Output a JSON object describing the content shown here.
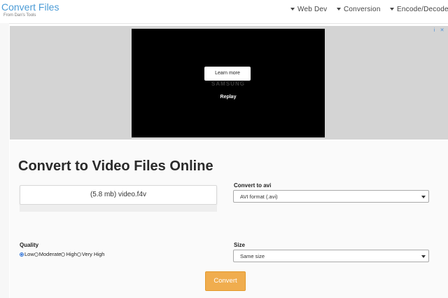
{
  "header": {
    "brand_title": "Convert Files",
    "brand_subtitle": "From Dan's Tools",
    "nav": [
      {
        "label": "Web Dev"
      },
      {
        "label": "Conversion"
      },
      {
        "label": "Encode/Decode"
      }
    ]
  },
  "ad": {
    "info_icon": "i",
    "close_icon": "✕",
    "learn_more": "Learn more",
    "brand": "SAMSUNG",
    "replay": "Replay"
  },
  "main": {
    "title": "Convert to Video Files Online",
    "file_label": "(5.8 mb) video.f4v",
    "convert_to_label": "Convert to avi",
    "format_selected": "AVI format (.avi)",
    "quality_label": "Quality",
    "quality_options": [
      "Low",
      "Moderate",
      "High",
      "Very High"
    ],
    "quality_selected": "Low",
    "size_label": "Size",
    "size_selected": "Same size",
    "convert_button": "Convert"
  },
  "colors": {
    "brand": "#4b9bd6",
    "convert_button": "#f0ad4e",
    "radio_selected": "#2a6fd6"
  }
}
